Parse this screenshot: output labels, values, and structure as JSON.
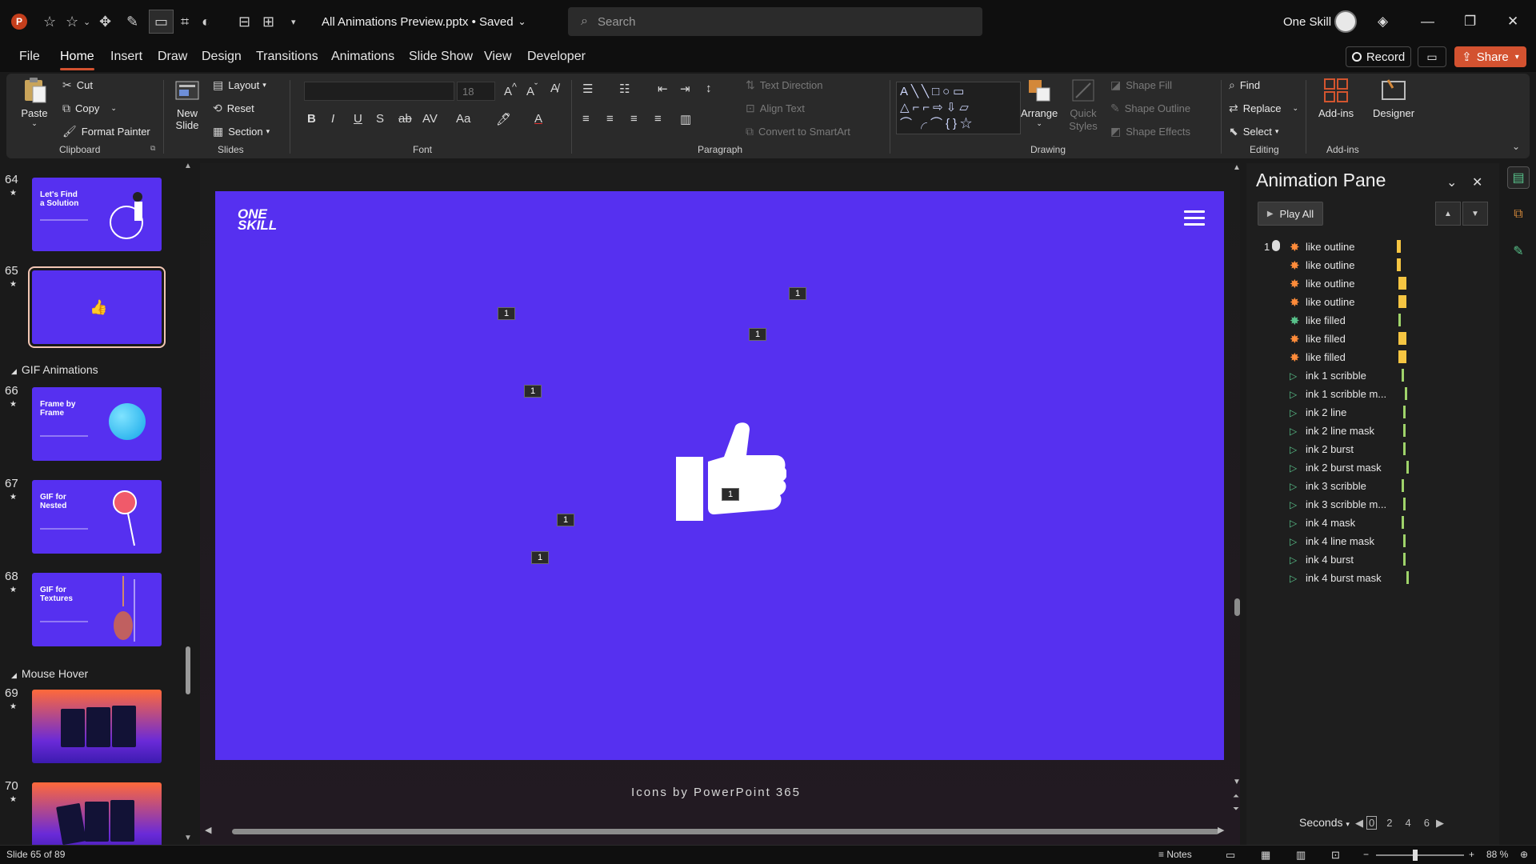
{
  "titlebar": {
    "document_title": "All Animations Preview.pptx • Saved",
    "search_placeholder": "Search",
    "user_name": "One Skill"
  },
  "menu": {
    "tabs": [
      "File",
      "Home",
      "Insert",
      "Draw",
      "Design",
      "Transitions",
      "Animations",
      "Slide Show",
      "View",
      "Developer"
    ],
    "active_tab": "Home",
    "record_label": "Record",
    "share_label": "Share"
  },
  "ribbon": {
    "clipboard": {
      "paste": "Paste",
      "cut": "Cut",
      "copy": "Copy",
      "format_painter": "Format Painter",
      "label": "Clipboard"
    },
    "slides": {
      "new_slide": "New Slide",
      "layout": "Layout",
      "reset": "Reset",
      "section": "Section",
      "label": "Slides"
    },
    "font": {
      "font_size": "18",
      "label": "Font"
    },
    "paragraph": {
      "text_direction": "Text Direction",
      "align_text": "Align Text",
      "convert_smartart": "Convert to SmartArt",
      "label": "Paragraph"
    },
    "drawing": {
      "arrange": "Arrange",
      "quick_styles": "Quick Styles",
      "shape_fill": "Shape Fill",
      "shape_outline": "Shape Outline",
      "shape_effects": "Shape Effects",
      "label": "Drawing"
    },
    "editing": {
      "find": "Find",
      "replace": "Replace",
      "select": "Select",
      "label": "Editing"
    },
    "addins": {
      "addins": "Add-ins",
      "designer": "Designer",
      "label": "Add-ins"
    }
  },
  "thumbnails": {
    "slides": [
      {
        "num": "64",
        "title": "Let's Find\na Solution",
        "style": "purple"
      },
      {
        "num": "65",
        "title": "",
        "style": "purple",
        "selected": true
      },
      {
        "num": "66",
        "title": "Frame by\nFrame",
        "style": "purple"
      },
      {
        "num": "67",
        "title": "GIF for\nNested",
        "style": "purple"
      },
      {
        "num": "68",
        "title": "GIF for\nTextures",
        "style": "purple"
      },
      {
        "num": "69",
        "title": "",
        "style": "orange"
      },
      {
        "num": "70",
        "title": "",
        "style": "orange"
      }
    ],
    "sections": [
      "GIF Animations",
      "Mouse Hover"
    ]
  },
  "slide": {
    "brand_line1": "ONE",
    "brand_line2": "SKILL",
    "background": "#5630f0",
    "anim_tag": "1",
    "caption": "Icons by PowerPoint 365"
  },
  "animation_pane": {
    "title": "Animation Pane",
    "play_all": "Play All",
    "sequence_number": "1",
    "items": [
      {
        "name": "like outline",
        "effect": "star-orange",
        "bar": "yellow"
      },
      {
        "name": "like outline",
        "effect": "star-orange",
        "bar": "yellow"
      },
      {
        "name": "like outline",
        "effect": "star-orange",
        "bar": "yellow"
      },
      {
        "name": "like outline",
        "effect": "star-orange",
        "bar": "yellow"
      },
      {
        "name": "like filled",
        "effect": "star-green",
        "bar": "green"
      },
      {
        "name": "like filled",
        "effect": "star-orange",
        "bar": "yellow"
      },
      {
        "name": "like filled",
        "effect": "star-orange",
        "bar": "yellow"
      },
      {
        "name": "ink 1 scribble",
        "effect": "play",
        "bar": "green"
      },
      {
        "name": "ink 1 scribble m...",
        "effect": "play",
        "bar": "green"
      },
      {
        "name": "ink 2 line",
        "effect": "play",
        "bar": "green"
      },
      {
        "name": "ink 2 line mask",
        "effect": "play",
        "bar": "green"
      },
      {
        "name": "ink 2 burst",
        "effect": "play",
        "bar": "green"
      },
      {
        "name": "ink 2 burst mask",
        "effect": "play",
        "bar": "green"
      },
      {
        "name": "ink 3 scribble",
        "effect": "play",
        "bar": "green"
      },
      {
        "name": "ink 3 scribble m...",
        "effect": "play",
        "bar": "green"
      },
      {
        "name": "ink 4 mask",
        "effect": "play",
        "bar": "green"
      },
      {
        "name": "ink 4 line mask",
        "effect": "play",
        "bar": "green"
      },
      {
        "name": "ink 4 burst",
        "effect": "play",
        "bar": "green"
      },
      {
        "name": "ink 4 burst mask",
        "effect": "play",
        "bar": "green"
      }
    ],
    "seconds_label": "Seconds",
    "timeline_ticks": [
      "0",
      "2",
      "4",
      "6"
    ]
  },
  "statusbar": {
    "slide_info": "Slide 65 of 89",
    "notes_label": "Notes",
    "zoom": "88 %"
  }
}
